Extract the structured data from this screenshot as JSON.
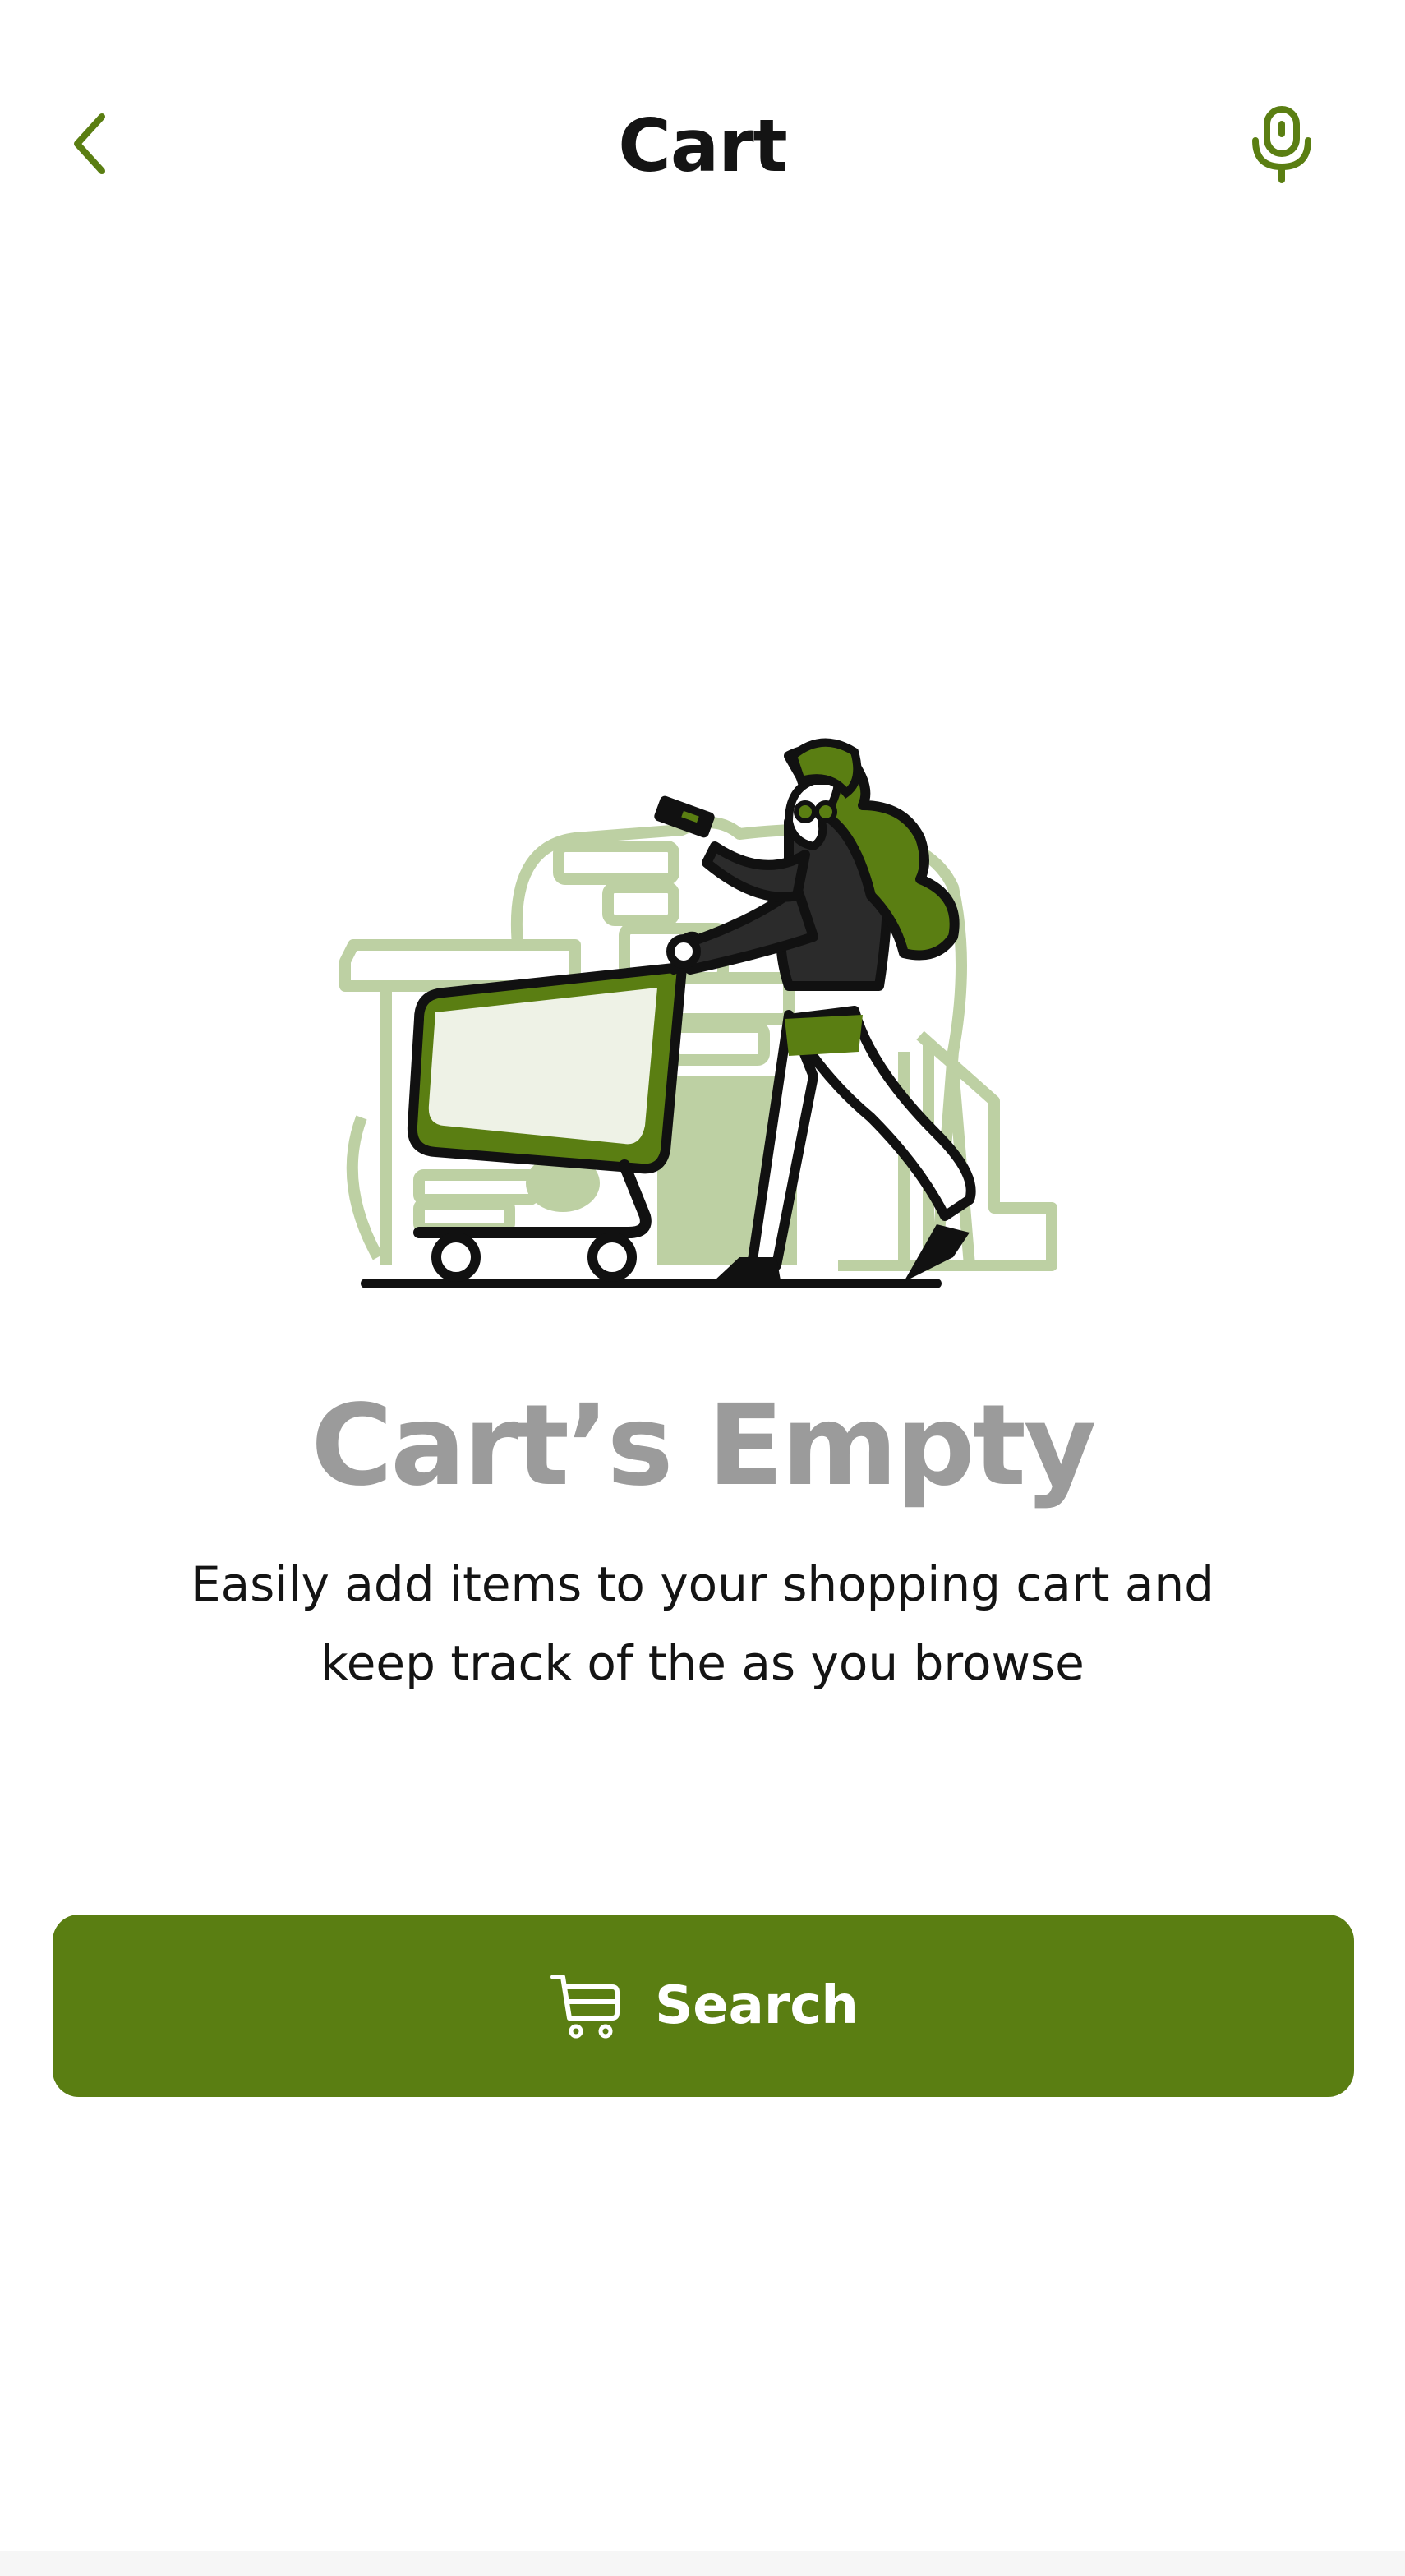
{
  "header": {
    "title": "Cart",
    "back_icon": "chevron-left-icon",
    "mic_icon": "microphone-icon"
  },
  "empty_state": {
    "title": "Cart’s Empty",
    "description": "Easily add items to your shopping cart and keep track of the as you browse",
    "illustration": "person-pushing-shopping-cart-illustration"
  },
  "search_button": {
    "label": "Search",
    "icon": "shopping-cart-icon"
  },
  "colors": {
    "accent": "#5a7e12",
    "accent_light": "#bdd0a3",
    "title_gray": "#9b9b9b",
    "text_dark": "#141414"
  }
}
